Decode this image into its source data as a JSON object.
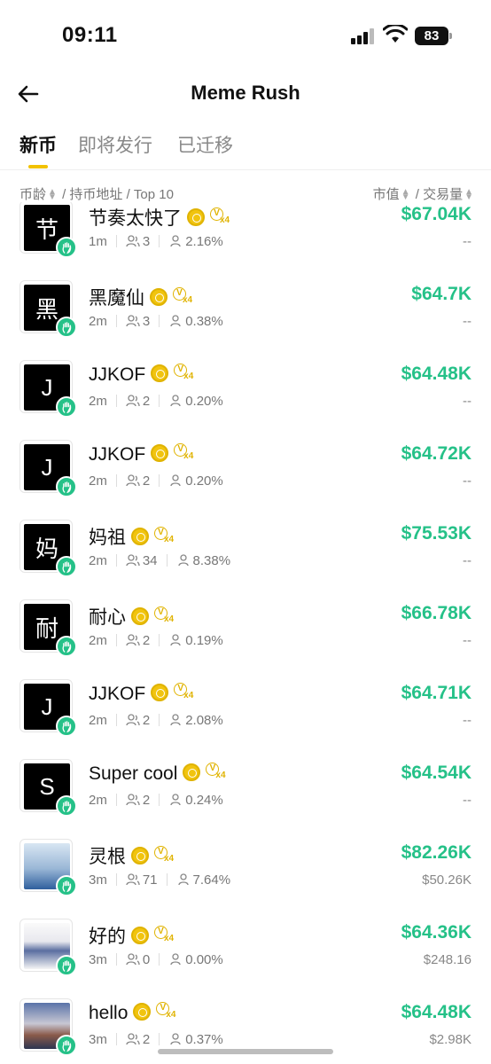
{
  "status": {
    "time": "09:11",
    "battery": "83"
  },
  "header": {
    "title": "Meme Rush"
  },
  "tabs": [
    {
      "label": "新币"
    },
    {
      "label": "即将发行"
    },
    {
      "label": "已迁移"
    }
  ],
  "columns": {
    "left_age": "币龄",
    "left_rest": "/ 持币地址 / Top 10",
    "right_mcap": "市值",
    "right_rest": "/ 交易量"
  },
  "rows": [
    {
      "avatar_char": "节",
      "name": "节奏太快了",
      "age": "1m",
      "holders": "3",
      "top10": "2.16%",
      "mcap": "$67.04K",
      "volume": "--"
    },
    {
      "avatar_char": "黑",
      "name": "黑魔仙",
      "age": "2m",
      "holders": "3",
      "top10": "0.38%",
      "mcap": "$64.7K",
      "volume": "--"
    },
    {
      "avatar_char": "J",
      "name": "JJKOF",
      "age": "2m",
      "holders": "2",
      "top10": "0.20%",
      "mcap": "$64.48K",
      "volume": "--"
    },
    {
      "avatar_char": "J",
      "name": "JJKOF",
      "age": "2m",
      "holders": "2",
      "top10": "0.20%",
      "mcap": "$64.72K",
      "volume": "--"
    },
    {
      "avatar_char": "妈",
      "name": "妈祖",
      "age": "2m",
      "holders": "34",
      "top10": "8.38%",
      "mcap": "$75.53K",
      "volume": "--"
    },
    {
      "avatar_char": "耐",
      "name": "耐心",
      "age": "2m",
      "holders": "2",
      "top10": "0.19%",
      "mcap": "$66.78K",
      "volume": "--"
    },
    {
      "avatar_char": "J",
      "name": "JJKOF",
      "age": "2m",
      "holders": "2",
      "top10": "2.08%",
      "mcap": "$64.71K",
      "volume": "--"
    },
    {
      "avatar_char": "S",
      "name": "Super cool",
      "age": "2m",
      "holders": "2",
      "top10": "0.24%",
      "mcap": "$64.54K",
      "volume": "--"
    },
    {
      "avatar_char": "",
      "name": "灵根",
      "age": "3m",
      "holders": "71",
      "top10": "7.64%",
      "mcap": "$82.26K",
      "volume": "$50.26K"
    },
    {
      "avatar_char": "",
      "name": "好的",
      "age": "3m",
      "holders": "0",
      "top10": "0.00%",
      "mcap": "$64.36K",
      "volume": "$248.16"
    },
    {
      "avatar_char": "",
      "name": "hello",
      "age": "3m",
      "holders": "2",
      "top10": "0.37%",
      "mcap": "$64.48K",
      "volume": "$2.98K"
    }
  ],
  "colors": {
    "accent": "#f2c200",
    "positive": "#25c188"
  }
}
